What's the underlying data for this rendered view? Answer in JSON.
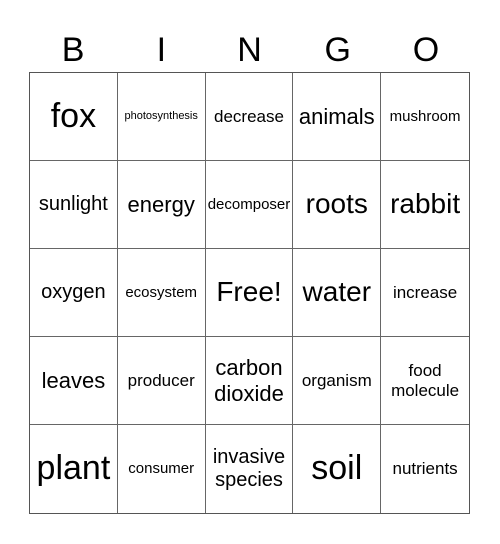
{
  "header": [
    "B",
    "I",
    "N",
    "G",
    "O"
  ],
  "cells": [
    {
      "text": "fox",
      "size": "xl"
    },
    {
      "text": "photosynthesis",
      "size": "xxs"
    },
    {
      "text": "decrease",
      "size": "s"
    },
    {
      "text": "animals",
      "size": "m"
    },
    {
      "text": "mushroom",
      "size": "xs"
    },
    {
      "text": "sunlight",
      "size": "ms"
    },
    {
      "text": "energy",
      "size": "m"
    },
    {
      "text": "decomposer",
      "size": "xs"
    },
    {
      "text": "roots",
      "size": "l"
    },
    {
      "text": "rabbit",
      "size": "l"
    },
    {
      "text": "oxygen",
      "size": "ms"
    },
    {
      "text": "ecosystem",
      "size": "xs"
    },
    {
      "text": "Free!",
      "size": "l"
    },
    {
      "text": "water",
      "size": "l"
    },
    {
      "text": "increase",
      "size": "s"
    },
    {
      "text": "leaves",
      "size": "m"
    },
    {
      "text": "producer",
      "size": "s"
    },
    {
      "text": "carbon dioxide",
      "size": "m"
    },
    {
      "text": "organism",
      "size": "s"
    },
    {
      "text": "food molecule",
      "size": "s"
    },
    {
      "text": "plant",
      "size": "xl"
    },
    {
      "text": "consumer",
      "size": "xs"
    },
    {
      "text": "invasive species",
      "size": "ms"
    },
    {
      "text": "soil",
      "size": "xl"
    },
    {
      "text": "nutrients",
      "size": "s"
    }
  ]
}
